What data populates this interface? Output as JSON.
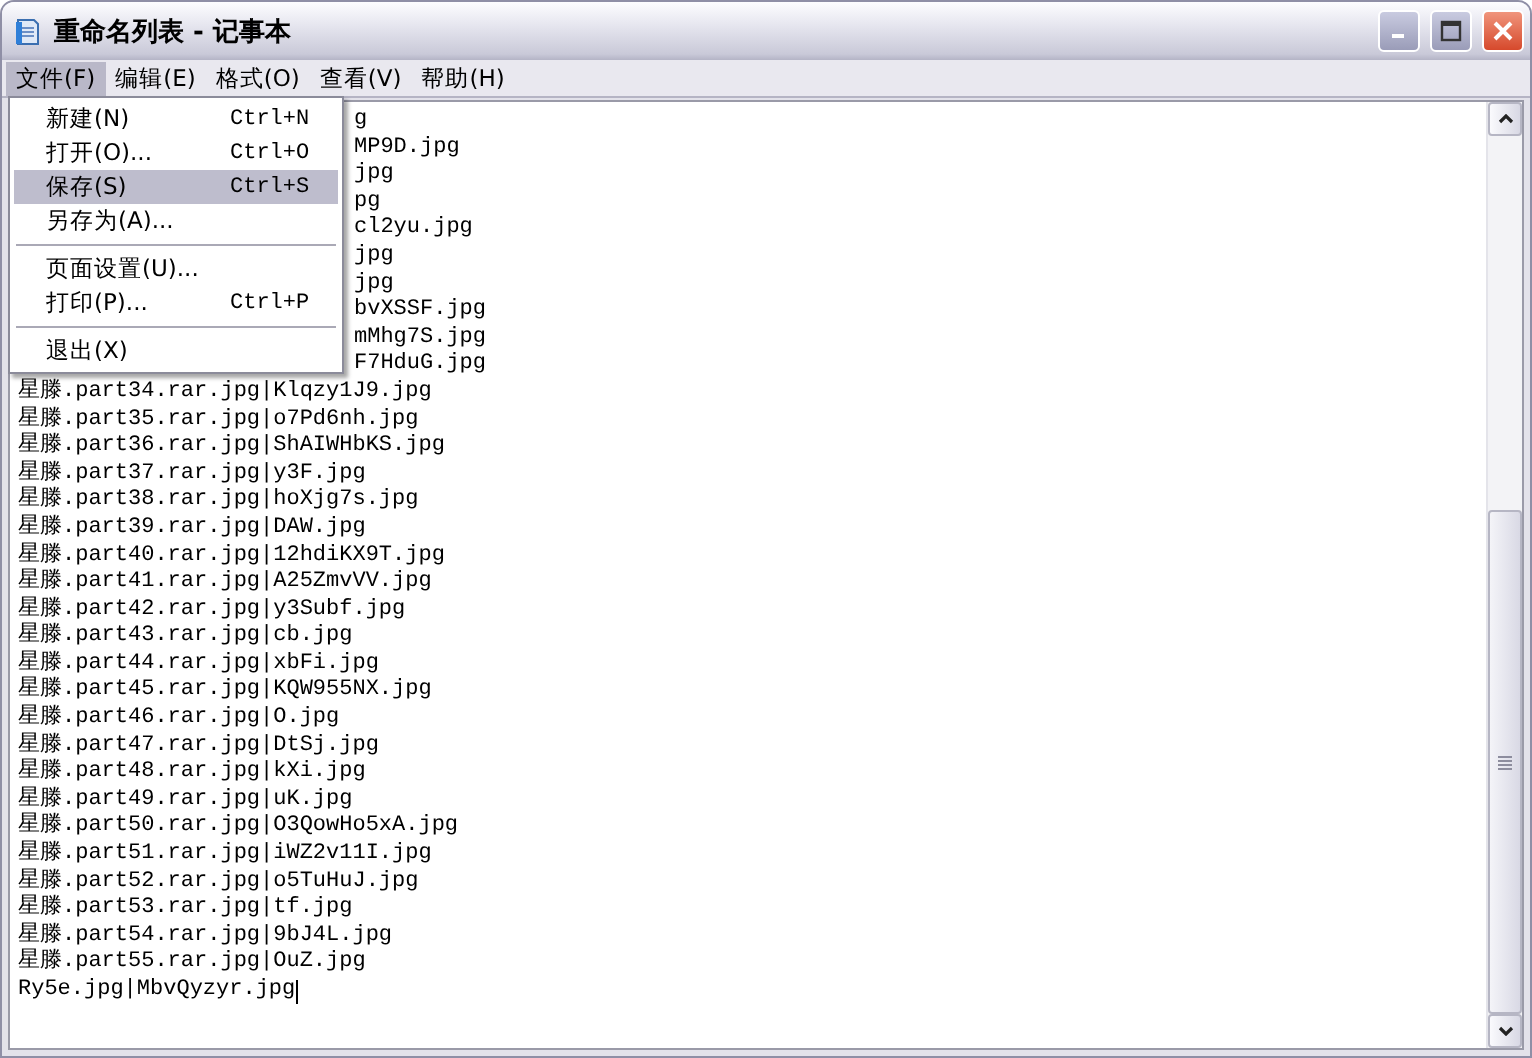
{
  "window": {
    "title": "重命名列表 - 记事本"
  },
  "menubar": [
    {
      "label": "文件(F)",
      "selected": true
    },
    {
      "label": "编辑(E)",
      "selected": false
    },
    {
      "label": "格式(O)",
      "selected": false
    },
    {
      "label": "查看(V)",
      "selected": false
    },
    {
      "label": "帮助(H)",
      "selected": false
    }
  ],
  "file_menu": [
    {
      "kind": "item",
      "label": "新建(N)",
      "shortcut": "Ctrl+N",
      "selected": false
    },
    {
      "kind": "item",
      "label": "打开(O)...",
      "shortcut": "Ctrl+O",
      "selected": false
    },
    {
      "kind": "item",
      "label": "保存(S)",
      "shortcut": "Ctrl+S",
      "selected": true
    },
    {
      "kind": "item",
      "label": "另存为(A)...",
      "selected": false
    },
    {
      "kind": "separator"
    },
    {
      "kind": "item",
      "label": "页面设置(U)...",
      "selected": false
    },
    {
      "kind": "item",
      "label": "打印(P)...",
      "shortcut": "Ctrl+P",
      "selected": false
    },
    {
      "kind": "separator"
    },
    {
      "kind": "item",
      "label": "退出(X)",
      "selected": false
    }
  ],
  "lines": [
    {
      "kind": "covered",
      "text": "g"
    },
    {
      "kind": "covered",
      "text": "MP9D.jpg"
    },
    {
      "kind": "covered",
      "text": "jpg"
    },
    {
      "kind": "covered",
      "text": "pg"
    },
    {
      "kind": "covered",
      "text": "cl2yu.jpg"
    },
    {
      "kind": "covered",
      "text": "jpg"
    },
    {
      "kind": "covered",
      "text": "jpg"
    },
    {
      "kind": "covered",
      "text": "bvXSSF.jpg"
    },
    {
      "kind": "covered",
      "text": "mMhg7S.jpg"
    },
    {
      "kind": "covered",
      "text": "F7HduG.jpg"
    },
    {
      "kind": "full",
      "text": "星滕.part34.rar.jpg|Klqzy1J9.jpg"
    },
    {
      "kind": "full",
      "text": "星滕.part35.rar.jpg|o7Pd6nh.jpg"
    },
    {
      "kind": "full",
      "text": "星滕.part36.rar.jpg|ShAIWHbKS.jpg"
    },
    {
      "kind": "full",
      "text": "星滕.part37.rar.jpg|y3F.jpg"
    },
    {
      "kind": "full",
      "text": "星滕.part38.rar.jpg|hoXjg7s.jpg"
    },
    {
      "kind": "full",
      "text": "星滕.part39.rar.jpg|DAW.jpg"
    },
    {
      "kind": "full",
      "text": "星滕.part40.rar.jpg|12hdiKX9T.jpg"
    },
    {
      "kind": "full",
      "text": "星滕.part41.rar.jpg|A25ZmvVV.jpg"
    },
    {
      "kind": "full",
      "text": "星滕.part42.rar.jpg|y3Subf.jpg"
    },
    {
      "kind": "full",
      "text": "星滕.part43.rar.jpg|cb.jpg"
    },
    {
      "kind": "full",
      "text": "星滕.part44.rar.jpg|xbFi.jpg"
    },
    {
      "kind": "full",
      "text": "星滕.part45.rar.jpg|KQW955NX.jpg"
    },
    {
      "kind": "full",
      "text": "星滕.part46.rar.jpg|O.jpg"
    },
    {
      "kind": "full",
      "text": "星滕.part47.rar.jpg|DtSj.jpg"
    },
    {
      "kind": "full",
      "text": "星滕.part48.rar.jpg|kXi.jpg"
    },
    {
      "kind": "full",
      "text": "星滕.part49.rar.jpg|uK.jpg"
    },
    {
      "kind": "full",
      "text": "星滕.part50.rar.jpg|O3QowHo5xA.jpg"
    },
    {
      "kind": "full",
      "text": "星滕.part51.rar.jpg|iWZ2v11I.jpg"
    },
    {
      "kind": "full",
      "text": "星滕.part52.rar.jpg|o5TuHuJ.jpg"
    },
    {
      "kind": "full",
      "text": "星滕.part53.rar.jpg|tf.jpg"
    },
    {
      "kind": "full",
      "text": "星滕.part54.rar.jpg|9bJ4L.jpg"
    },
    {
      "kind": "full",
      "text": "星滕.part55.rar.jpg|OuZ.jpg"
    },
    {
      "kind": "full",
      "text": "Ry5e.jpg|MbvQyzyr.jpg",
      "caret": true
    }
  ]
}
